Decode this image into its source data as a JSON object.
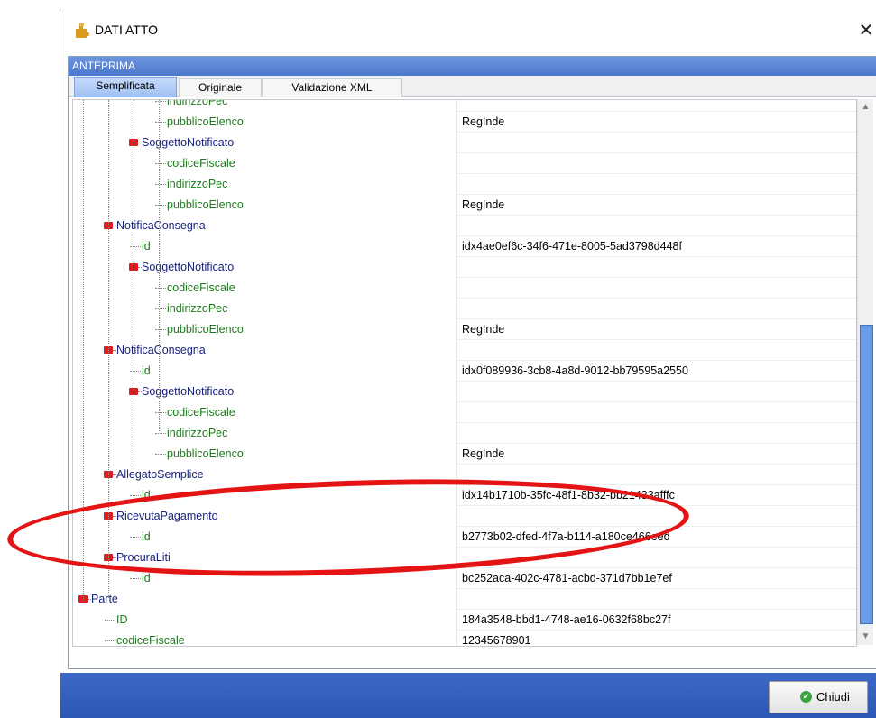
{
  "window": {
    "title": "DATI ATTO"
  },
  "panel": {
    "header": "ANTEPRIMA"
  },
  "tabs": [
    {
      "label": "Semplificata",
      "active": true
    },
    {
      "label": "Originale",
      "active": false
    },
    {
      "label": "Validazione XML",
      "active": false
    }
  ],
  "tree_rows": [
    {
      "name": "indirizzoPec",
      "value": "",
      "level": 3,
      "node": false
    },
    {
      "name": "pubblicoElenco",
      "value": "RegInde",
      "level": 3,
      "node": false
    },
    {
      "name": "SoggettoNotificato",
      "value": "",
      "level": 2,
      "node": true
    },
    {
      "name": "codiceFiscale",
      "value": "",
      "level": 3,
      "node": false
    },
    {
      "name": "indirizzoPec",
      "value": "",
      "level": 3,
      "node": false
    },
    {
      "name": "pubblicoElenco",
      "value": "RegInde",
      "level": 3,
      "node": false
    },
    {
      "name": "NotificaConsegna",
      "value": "",
      "level": 1,
      "node": true
    },
    {
      "name": "id",
      "value": "idx4ae0ef6c-34f6-471e-8005-5ad3798d448f",
      "level": 2,
      "node": false
    },
    {
      "name": "SoggettoNotificato",
      "value": "",
      "level": 2,
      "node": true
    },
    {
      "name": "codiceFiscale",
      "value": "",
      "level": 3,
      "node": false
    },
    {
      "name": "indirizzoPec",
      "value": "",
      "level": 3,
      "node": false
    },
    {
      "name": "pubblicoElenco",
      "value": "RegInde",
      "level": 3,
      "node": false
    },
    {
      "name": "NotificaConsegna",
      "value": "",
      "level": 1,
      "node": true
    },
    {
      "name": "id",
      "value": "idx0f089936-3cb8-4a8d-9012-bb79595a2550",
      "level": 2,
      "node": false
    },
    {
      "name": "SoggettoNotificato",
      "value": "",
      "level": 2,
      "node": true
    },
    {
      "name": "codiceFiscale",
      "value": "",
      "level": 3,
      "node": false
    },
    {
      "name": "indirizzoPec",
      "value": "",
      "level": 3,
      "node": false
    },
    {
      "name": "pubblicoElenco",
      "value": "RegInde",
      "level": 3,
      "node": false
    },
    {
      "name": "AllegatoSemplice",
      "value": "",
      "level": 1,
      "node": true
    },
    {
      "name": "id",
      "value": "idx14b1710b-35fc-48f1-8b32-bb21433afffc",
      "level": 2,
      "node": false
    },
    {
      "name": "RicevutaPagamento",
      "value": "",
      "level": 1,
      "node": true
    },
    {
      "name": "id",
      "value": "b2773b02-dfed-4f7a-b114-a180ce466eed",
      "level": 2,
      "node": false
    },
    {
      "name": "ProcuraLiti",
      "value": "",
      "level": 1,
      "node": true
    },
    {
      "name": "id",
      "value": "bc252aca-402c-4781-acbd-371d7bb1e7ef",
      "level": 2,
      "node": false
    },
    {
      "name": "Parte",
      "value": "",
      "level": 0,
      "node": true
    },
    {
      "name": "ID",
      "value": "184a3548-bbd1-4748-ae16-0632f68bc27f",
      "level": 1,
      "node": false
    },
    {
      "name": "codiceFiscale",
      "value": "12345678901",
      "level": 1,
      "node": false
    }
  ],
  "footer": {
    "close_label": "Chiudi"
  },
  "colors": {
    "node_text": "#1a237e",
    "leaf_text": "#1e7a1e",
    "minus_icon": "#e01d1d",
    "annotation": "#e51414"
  },
  "icons": {
    "app": "puzzle-icon",
    "close": "close-icon",
    "ok": "check-circle-icon"
  }
}
